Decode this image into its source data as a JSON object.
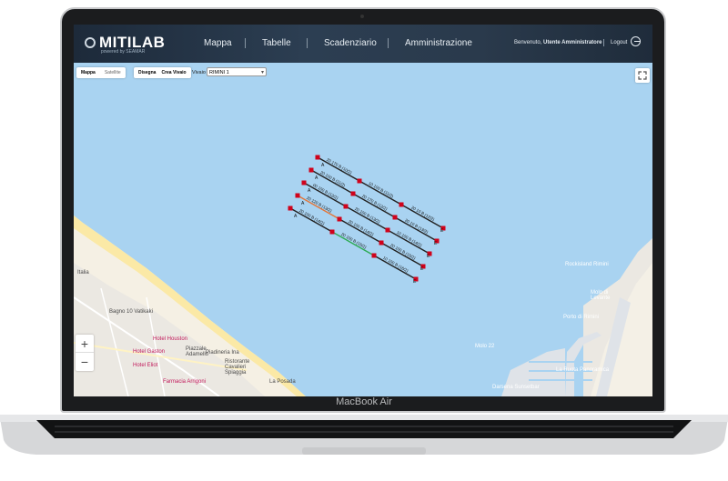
{
  "app": {
    "logo": "MITILAB",
    "logo_sub": "powered by SEAMAR",
    "nav": [
      "Mappa",
      "Tabelle",
      "Scadenziario",
      "Amministrazione"
    ],
    "welcome_prefix": "Benvenuto,",
    "welcome_user": "Utente Amministratore",
    "logout": "Logout"
  },
  "toolbar": {
    "map_type": [
      "Mappa",
      "Satellite"
    ],
    "draw": "Disegna",
    "create": "Crea Vivaio",
    "vivaio_label": "Vivaio",
    "vivaio_value": "RIMINI 1"
  },
  "zoom": {
    "in": "+",
    "out": "−"
  },
  "device": {
    "brand": "MacBook Air"
  },
  "map_labels": [
    {
      "text": "Bagno 10 Vatikaki",
      "type": "land"
    },
    {
      "text": "Hotel Houston",
      "type": "pink"
    },
    {
      "text": "Hotel Gaston",
      "type": "pink"
    },
    {
      "text": "Piazzale Adamello",
      "type": "land"
    },
    {
      "text": "Piadineria Ina",
      "type": "land"
    },
    {
      "text": "Hotel Eliot",
      "type": "pink"
    },
    {
      "text": "Farmacia Arrigoni",
      "type": "pink"
    },
    {
      "text": "Ristorante Cavalieri Spiaggia",
      "type": "land"
    },
    {
      "text": "La Posada",
      "type": "land"
    },
    {
      "text": "Rockisland Rimini",
      "type": "water"
    },
    {
      "text": "Molo di Levante",
      "type": "water"
    },
    {
      "text": "Porto di Rimini",
      "type": "water"
    },
    {
      "text": "Molo 22",
      "type": "water"
    },
    {
      "text": "La Ruota Panoramica",
      "type": "water"
    },
    {
      "text": "Darsena Sunsetbar",
      "type": "water"
    },
    {
      "text": "Italia",
      "type": "land"
    }
  ],
  "longlines": [
    {
      "start": "A",
      "end": "E",
      "codes": [
        "20 170 B (10/2)",
        "10 100 B (11/2)",
        "20 10 B (12/2)"
      ],
      "colors": [
        "#222222",
        "#222222",
        "#222222"
      ]
    },
    {
      "start": "A",
      "end": "E",
      "codes": [
        "20 100 B (11/2)",
        "20 170 B (12/2)",
        "20 10 B (13/2)"
      ],
      "colors": [
        "#222222",
        "#222222",
        "#222222"
      ]
    },
    {
      "start": "A",
      "end": "E",
      "codes": [
        "00 100 B (12/2)",
        "20 100 B (13/2)",
        "10 100 B (14/2)"
      ],
      "colors": [
        "#222222",
        "#222222",
        "#222222"
      ]
    },
    {
      "start": "A",
      "end": "E",
      "codes": [
        "20 120 B (13/2)",
        "20 100 B (14/2)",
        "20 100 B (15/2)"
      ],
      "colors": [
        "#e2763a",
        "#222222",
        "#222222"
      ]
    },
    {
      "start": "A",
      "end": "E",
      "codes": [
        "20 100 B (14/2)",
        "20 100 B (15/2)",
        "10 100 B (16/2)"
      ],
      "colors": [
        "#222222",
        "#2eab55",
        "#222222"
      ]
    }
  ]
}
